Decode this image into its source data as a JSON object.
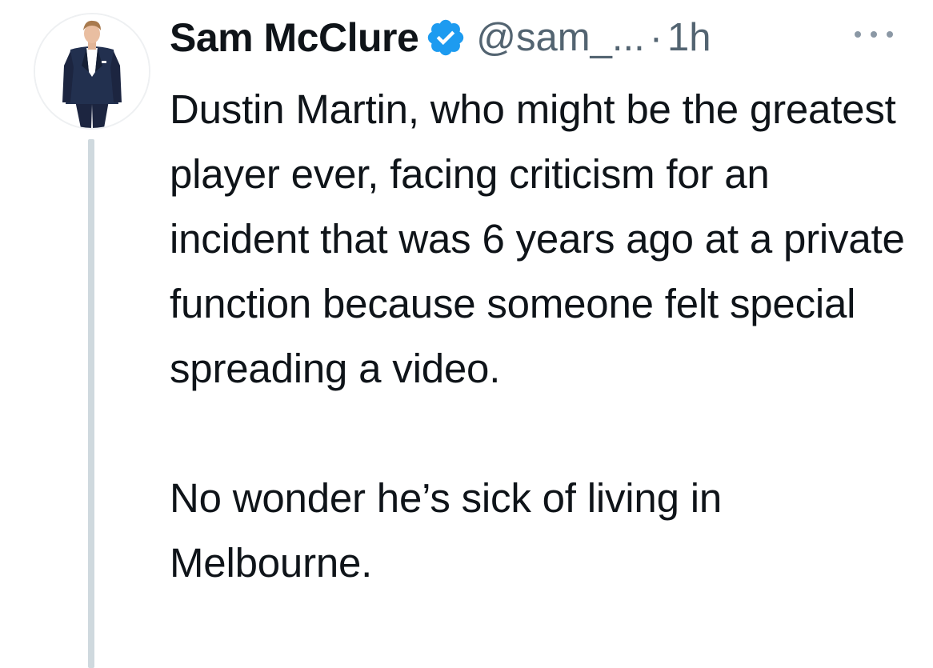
{
  "tweet": {
    "author": {
      "display_name": "Sam McClure",
      "handle": "@sam_...",
      "verified": true
    },
    "separator": "·",
    "time": "1h",
    "more_menu_icon": "more-dots-icon",
    "body": {
      "paragraph_1": "Dustin Martin, who might be the greatest player ever, facing criticism for an incident that was 6 years ago at a private function because someone felt special spreading a video.",
      "paragraph_2": "No wonder he’s sick of living in Melbourne."
    }
  },
  "colors": {
    "text_primary": "#0f1419",
    "text_secondary": "#536471",
    "verified_blue": "#1d9bf0",
    "thread_line": "#cfd9de",
    "suit_navy": "#1c2540"
  }
}
